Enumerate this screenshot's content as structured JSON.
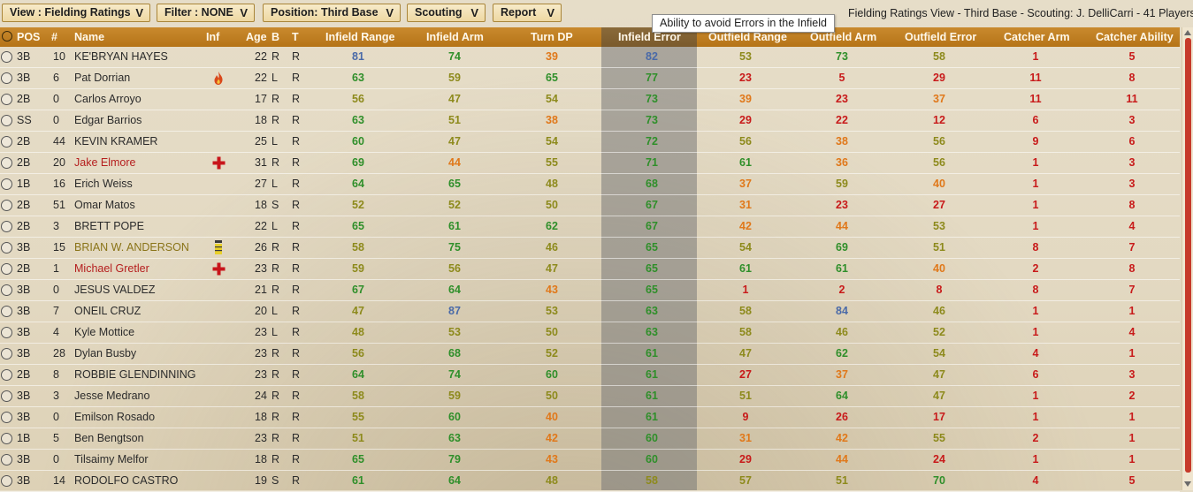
{
  "toolbar": {
    "view": "View : Fielding Ratings",
    "filter": "Filter : NONE",
    "position": "Position: Third Base",
    "scouting": "Scouting",
    "report": "Report",
    "status": "Fielding Ratings View - Third Base - Scouting: J. DelliCarri - 41 Players"
  },
  "tooltip": "Ability to avoid Errors in the Infield",
  "columns": {
    "pos": "POS",
    "num": "#",
    "name": "Name",
    "inf": "Inf",
    "age": "Age",
    "b": "B",
    "t": "T",
    "ifr": "Infield Range",
    "ifa": "Infield Arm",
    "tdp": "Turn DP",
    "ife": "Infield Error",
    "ofr": "Outfield Range",
    "ofa": "Outfield Arm",
    "ofe": "Outfield Error",
    "ca": "Catcher Arm",
    "cab": "Catcher Ability"
  },
  "colors": {
    "blue": "#4a6aa8",
    "green": "#2f8f2a",
    "olive": "#8d8a1c",
    "orange": "#e0781a",
    "red": "#c81a1a",
    "name_red": "#b51e1e",
    "name_gold": "#8a7418",
    "header": "#bf7f22"
  },
  "players": [
    {
      "pos": "3B",
      "num": "10",
      "name": "KE'BRYAN HAYES",
      "inf": "",
      "age": "22",
      "b": "R",
      "t": "R",
      "ifr": "81",
      "ifa": "74",
      "tdp": "39",
      "ife": "82",
      "ofr": "53",
      "ofa": "73",
      "ofe": "58",
      "ca": "1",
      "cab": "5"
    },
    {
      "pos": "3B",
      "num": "6",
      "name": "Pat Dorrian",
      "inf": "flame",
      "age": "22",
      "b": "L",
      "t": "R",
      "ifr": "63",
      "ifa": "59",
      "tdp": "65",
      "ife": "77",
      "ofr": "23",
      "ofa": "5",
      "ofe": "29",
      "ca": "11",
      "cab": "8"
    },
    {
      "pos": "2B",
      "num": "0",
      "name": "Carlos Arroyo",
      "inf": "",
      "age": "17",
      "b": "R",
      "t": "R",
      "ifr": "56",
      "ifa": "47",
      "tdp": "54",
      "ife": "73",
      "ofr": "39",
      "ofa": "23",
      "ofe": "37",
      "ca": "11",
      "cab": "11"
    },
    {
      "pos": "SS",
      "num": "0",
      "name": "Edgar Barrios",
      "inf": "",
      "age": "18",
      "b": "R",
      "t": "R",
      "ifr": "63",
      "ifa": "51",
      "tdp": "38",
      "ife": "73",
      "ofr": "29",
      "ofa": "22",
      "ofe": "12",
      "ca": "6",
      "cab": "3"
    },
    {
      "pos": "2B",
      "num": "44",
      "name": "KEVIN KRAMER",
      "inf": "",
      "age": "25",
      "b": "L",
      "t": "R",
      "ifr": "60",
      "ifa": "47",
      "tdp": "54",
      "ife": "72",
      "ofr": "56",
      "ofa": "38",
      "ofe": "56",
      "ca": "9",
      "cab": "6"
    },
    {
      "pos": "2B",
      "num": "20",
      "name": "Jake Elmore",
      "inf": "injury",
      "name_color": "red",
      "age": "31",
      "b": "R",
      "t": "R",
      "ifr": "69",
      "ifa": "44",
      "tdp": "55",
      "ife": "71",
      "ofr": "61",
      "ofa": "36",
      "ofe": "56",
      "ca": "1",
      "cab": "3"
    },
    {
      "pos": "1B",
      "num": "16",
      "name": "Erich Weiss",
      "inf": "",
      "age": "27",
      "b": "L",
      "t": "R",
      "ifr": "64",
      "ifa": "65",
      "tdp": "48",
      "ife": "68",
      "ofr": "37",
      "ofa": "59",
      "ofe": "40",
      "ca": "1",
      "cab": "3"
    },
    {
      "pos": "2B",
      "num": "51",
      "name": "Omar Matos",
      "inf": "",
      "age": "18",
      "b": "S",
      "t": "R",
      "ifr": "52",
      "ifa": "52",
      "tdp": "50",
      "ife": "67",
      "ofr": "31",
      "ofa": "23",
      "ofe": "27",
      "ca": "1",
      "cab": "8"
    },
    {
      "pos": "2B",
      "num": "3",
      "name": "BRETT POPE",
      "inf": "",
      "age": "22",
      "b": "L",
      "t": "R",
      "ifr": "65",
      "ifa": "61",
      "tdp": "62",
      "ife": "67",
      "ofr": "42",
      "ofa": "44",
      "ofe": "53",
      "ca": "1",
      "cab": "4"
    },
    {
      "pos": "3B",
      "num": "15",
      "name": "BRIAN W. ANDERSON",
      "inf": "bar",
      "name_color": "gold",
      "age": "26",
      "b": "R",
      "t": "R",
      "ifr": "58",
      "ifa": "75",
      "tdp": "46",
      "ife": "65",
      "ofr": "54",
      "ofa": "69",
      "ofe": "51",
      "ca": "8",
      "cab": "7"
    },
    {
      "pos": "2B",
      "num": "1",
      "name": "Michael Gretler",
      "inf": "injury",
      "name_color": "red",
      "age": "23",
      "b": "R",
      "t": "R",
      "ifr": "59",
      "ifa": "56",
      "tdp": "47",
      "ife": "65",
      "ofr": "61",
      "ofa": "61",
      "ofe": "40",
      "ca": "2",
      "cab": "8"
    },
    {
      "pos": "3B",
      "num": "0",
      "name": "JESUS VALDEZ",
      "inf": "",
      "age": "21",
      "b": "R",
      "t": "R",
      "ifr": "67",
      "ifa": "64",
      "tdp": "43",
      "ife": "65",
      "ofr": "1",
      "ofa": "2",
      "ofe": "8",
      "ca": "8",
      "cab": "7"
    },
    {
      "pos": "3B",
      "num": "7",
      "name": "ONEIL CRUZ",
      "inf": "",
      "age": "20",
      "b": "L",
      "t": "R",
      "ifr": "47",
      "ifa": "87",
      "tdp": "53",
      "ife": "63",
      "ofr": "58",
      "ofa": "84",
      "ofe": "46",
      "ca": "1",
      "cab": "1"
    },
    {
      "pos": "3B",
      "num": "4",
      "name": "Kyle Mottice",
      "inf": "",
      "age": "23",
      "b": "L",
      "t": "R",
      "ifr": "48",
      "ifa": "53",
      "tdp": "50",
      "ife": "63",
      "ofr": "58",
      "ofa": "46",
      "ofe": "52",
      "ca": "1",
      "cab": "4"
    },
    {
      "pos": "3B",
      "num": "28",
      "name": "Dylan Busby",
      "inf": "",
      "age": "23",
      "b": "R",
      "t": "R",
      "ifr": "56",
      "ifa": "68",
      "tdp": "52",
      "ife": "61",
      "ofr": "47",
      "ofa": "62",
      "ofe": "54",
      "ca": "4",
      "cab": "1"
    },
    {
      "pos": "2B",
      "num": "8",
      "name": "ROBBIE GLENDINNING",
      "inf": "",
      "age": "23",
      "b": "R",
      "t": "R",
      "ifr": "64",
      "ifa": "74",
      "tdp": "60",
      "ife": "61",
      "ofr": "27",
      "ofa": "37",
      "ofe": "47",
      "ca": "6",
      "cab": "3"
    },
    {
      "pos": "3B",
      "num": "3",
      "name": "Jesse Medrano",
      "inf": "",
      "age": "24",
      "b": "R",
      "t": "R",
      "ifr": "58",
      "ifa": "59",
      "tdp": "50",
      "ife": "61",
      "ofr": "51",
      "ofa": "64",
      "ofe": "47",
      "ca": "1",
      "cab": "2"
    },
    {
      "pos": "3B",
      "num": "0",
      "name": "Emilson Rosado",
      "inf": "",
      "age": "18",
      "b": "R",
      "t": "R",
      "ifr": "55",
      "ifa": "60",
      "tdp": "40",
      "ife": "61",
      "ofr": "9",
      "ofa": "26",
      "ofe": "17",
      "ca": "1",
      "cab": "1"
    },
    {
      "pos": "1B",
      "num": "5",
      "name": "Ben Bengtson",
      "inf": "",
      "age": "23",
      "b": "R",
      "t": "R",
      "ifr": "51",
      "ifa": "63",
      "tdp": "42",
      "ife": "60",
      "ofr": "31",
      "ofa": "42",
      "ofe": "55",
      "ca": "2",
      "cab": "1"
    },
    {
      "pos": "3B",
      "num": "0",
      "name": "Tilsaimy Melfor",
      "inf": "",
      "age": "18",
      "b": "R",
      "t": "R",
      "ifr": "65",
      "ifa": "79",
      "tdp": "43",
      "ife": "60",
      "ofr": "29",
      "ofa": "44",
      "ofe": "24",
      "ca": "1",
      "cab": "1"
    },
    {
      "pos": "3B",
      "num": "14",
      "name": "RODOLFO CASTRO",
      "inf": "",
      "age": "19",
      "b": "S",
      "t": "R",
      "ifr": "61",
      "ifa": "64",
      "tdp": "48",
      "ife": "58",
      "ofr": "57",
      "ofa": "51",
      "ofe": "70",
      "ca": "4",
      "cab": "5"
    }
  ]
}
